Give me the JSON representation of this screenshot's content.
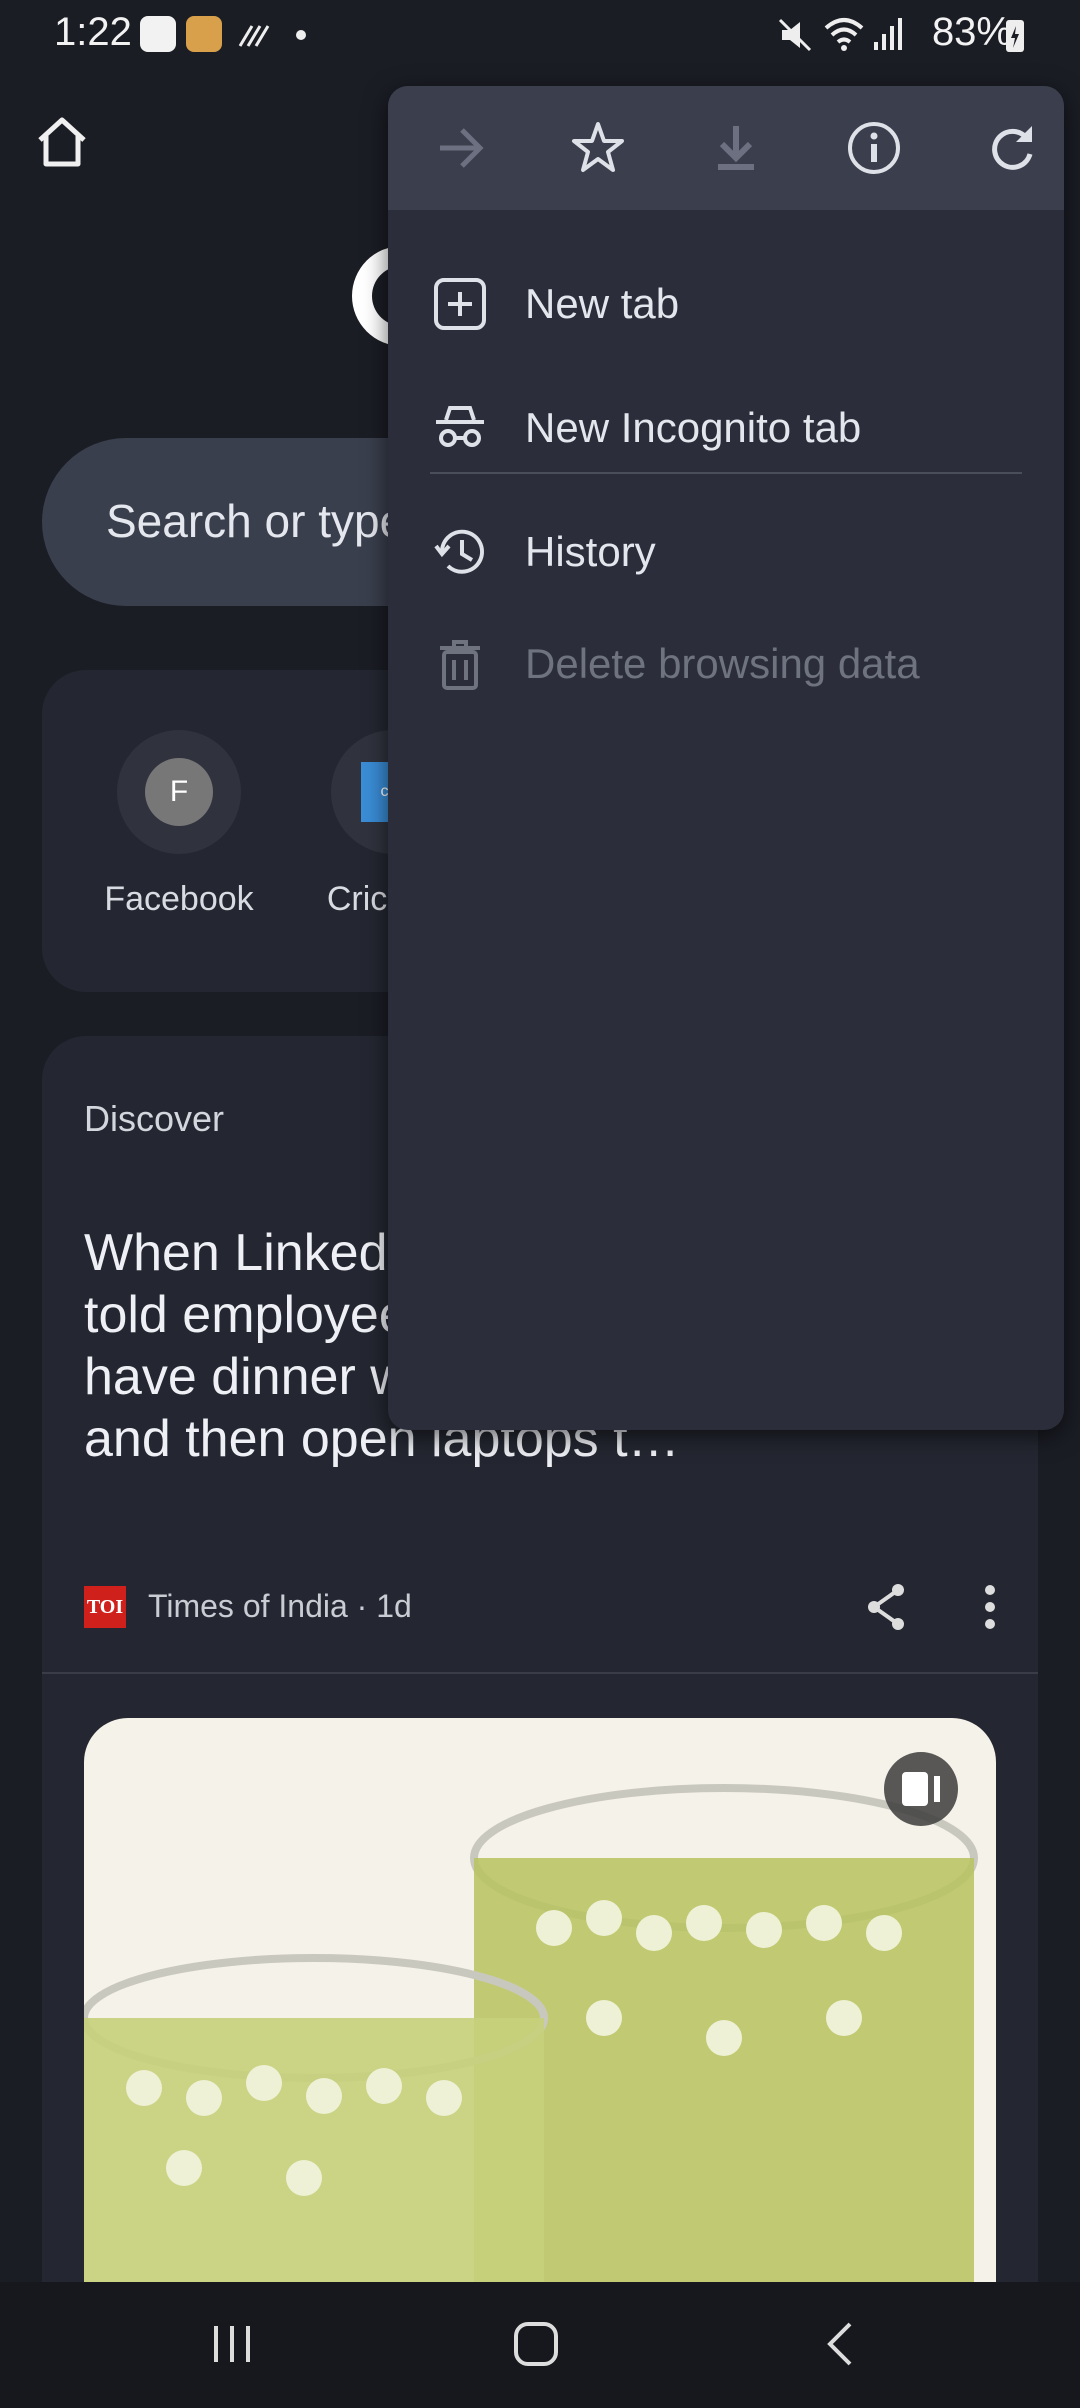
{
  "status_bar": {
    "time": "1:22",
    "battery": "83%"
  },
  "page": {
    "search_placeholder": "Search or type web address",
    "shortcuts": [
      {
        "label": "Facebook",
        "letter": "F"
      },
      {
        "label": "Cricbuzz",
        "letter": "cric"
      }
    ],
    "discover": {
      "title": "Discover",
      "headline": "When LinkedIn co-founder told employees: Go home, have dinner with family, and then open laptops t…",
      "source": "Times of India · 1d",
      "source_logo": "TOI"
    }
  },
  "menu": {
    "toolbar": [
      "forward-icon",
      "bookmark-star-icon",
      "download-icon",
      "info-icon",
      "reload-icon"
    ],
    "items": [
      {
        "label": "New tab",
        "icon": "new-tab-icon"
      },
      {
        "label": "New Incognito tab",
        "icon": "incognito-icon"
      },
      {
        "label": "History",
        "icon": "history-icon"
      },
      {
        "label": "Delete browsing data",
        "icon": "trash-icon",
        "disabled": true
      }
    ]
  },
  "colors": {
    "background": "#1b1d25",
    "menu": "#2b2e3a",
    "toolbar": "#3b3f4d",
    "toi_red": "#d0201c"
  }
}
